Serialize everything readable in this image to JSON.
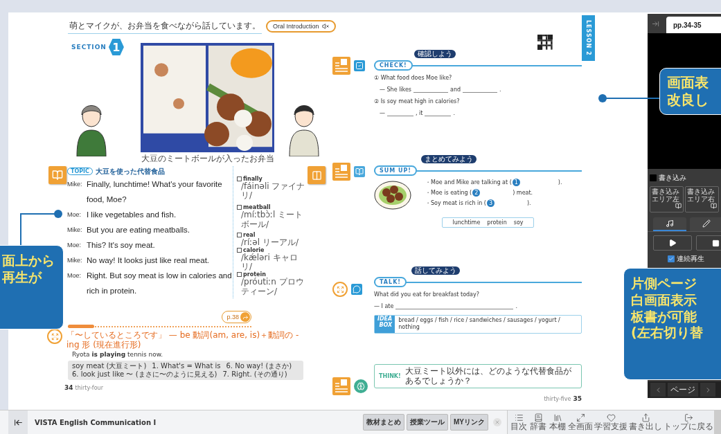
{
  "book": {
    "left_page": {
      "scene": "萌とマイクが、お弁当を食べながら話しています。",
      "oral_button": "Oral Introduction",
      "section_label": "SECTION",
      "section_number": "1",
      "photo": {
        "kind": "picture",
        "caption": "大豆のミートボールが入ったお弁当"
      },
      "topic_tag": "TOPIC",
      "topic": "大豆を使った代替食品",
      "dialogue": [
        {
          "speaker": "Mike:",
          "lines": [
            "Finally, lunchtime!  What's your favorite",
            "food, Moe?"
          ]
        },
        {
          "speaker": "Moe:",
          "lines": [
            "I like vegetables and fish."
          ]
        },
        {
          "speaker": "Mike:",
          "lines": [
            "But you are eating meatballs."
          ]
        },
        {
          "speaker": "Moe:",
          "lines": [
            "This?  It's soy meat."
          ]
        },
        {
          "speaker": "Mike:",
          "lines": [
            "No way!  It looks just like real meat."
          ]
        },
        {
          "speaker": "Moe:",
          "lines": [
            "Right.  But soy meat is low in calories and",
            "rich in protein."
          ]
        }
      ],
      "glossary": [
        {
          "word": "finally",
          "reading": "/fáinəli ファイナリ/",
          "checked": false
        },
        {
          "word": "meatball",
          "reading": "/míːtbɔ̀ːl ミートボール/",
          "checked": false
        },
        {
          "word": "real",
          "reading": "/ríːəl リーアル/",
          "checked": false
        },
        {
          "word": "calorie",
          "reading": "/kǽləri キャロリ/",
          "checked": false
        },
        {
          "word": "protein",
          "reading": "/próutiːn プロウティーン/",
          "checked": false
        }
      ],
      "page_link": "p.38",
      "study_rule": "「〜しているところです」 — be 動詞(am, are, is)＋動詞の -ing 形 (現在進行形)",
      "study_example": "Ryota **is playing** tennis now.",
      "notes": [
        "soy meat (大豆ミート)",
        "1. What's = What is",
        "6. No way! (まさか)",
        "6. look just like 〜 (まさに〜のように見える)",
        "7. Right. (その通り)"
      ],
      "page_number": "34",
      "page_word": "thirty-four"
    },
    "right_page": {
      "lesson_tab": "LESSON 2",
      "check": {
        "title": "CHECK!",
        "subtitle": "確認しよう",
        "items": [
          {
            "question": "① What food does Moe like?",
            "answer_parts": [
              "— She likes",
              "and",
              "."
            ]
          },
          {
            "question": "② Is soy meat high in calories?",
            "answer_parts": [
              "—",
              ", it",
              "."
            ]
          }
        ]
      },
      "sum_up": {
        "title": "SUM UP!",
        "subtitle": "まとめてみよう",
        "items": [
          {
            "before": "・Moe and Mike are talking at (",
            "number": "1",
            "after": ")."
          },
          {
            "before": "・Moe is eating (",
            "number": "2",
            "after": ") meat."
          },
          {
            "before": "・Soy meat is rich in (",
            "number": "3",
            "after": ")."
          }
        ],
        "words": [
          "lunchtime",
          "protein",
          "soy"
        ]
      },
      "talk": {
        "title": "TALK!",
        "subtitle": "話してみよう",
        "question": "What did you eat for breakfast today?",
        "answer_parts": [
          "— I ate",
          "."
        ],
        "idea_label": [
          "IDEA",
          "BOX"
        ],
        "ideas": "bread / eggs / fish / rice / sandwiches / sausages / yogurt / nothing"
      },
      "think": {
        "title": "THINK!",
        "text": "大豆ミート以外には、どのような代替食品があるでしょうか？"
      },
      "page_word": "thirty-five",
      "page_number": "35"
    }
  },
  "viewer_panel": {
    "page_label": "pp.34-35",
    "write_toggle": {
      "label": "書き込み",
      "checked": false
    },
    "area_buttons": [
      {
        "lines": [
          "書き込み",
          "エリア左"
        ]
      },
      {
        "lines": [
          "書き込み",
          "エリア右"
        ]
      }
    ],
    "tabs": [
      {
        "kind": "audio",
        "selected": true
      },
      {
        "kind": "pen",
        "selected": false
      }
    ],
    "continuous": {
      "label": "連続再生",
      "checked": true
    },
    "nav_label": "ページ"
  },
  "callouts": [
    {
      "lines": [
        "面上から",
        "再生が"
      ]
    },
    {
      "lines": [
        "画面表",
        "改良し"
      ]
    },
    {
      "lines": [
        "片側ページ",
        "白画面表示",
        "板書が可能",
        "(左右切り替"
      ]
    }
  ],
  "bottom_bar": {
    "title": "VISTA English Communication I",
    "tabs": [
      "教材まとめ",
      "授業ツール",
      "MYリンク"
    ],
    "tools": [
      {
        "kind": "toc",
        "label": "目次"
      },
      {
        "kind": "dictionary",
        "label": "辞書"
      },
      {
        "kind": "shelf",
        "label": "本棚"
      },
      {
        "kind": "fullscreen",
        "label": "全画面"
      },
      {
        "kind": "support",
        "label": "学習支援"
      },
      {
        "kind": "export",
        "label": "書き出し"
      },
      {
        "kind": "top",
        "label": "トップに戻る"
      }
    ]
  }
}
